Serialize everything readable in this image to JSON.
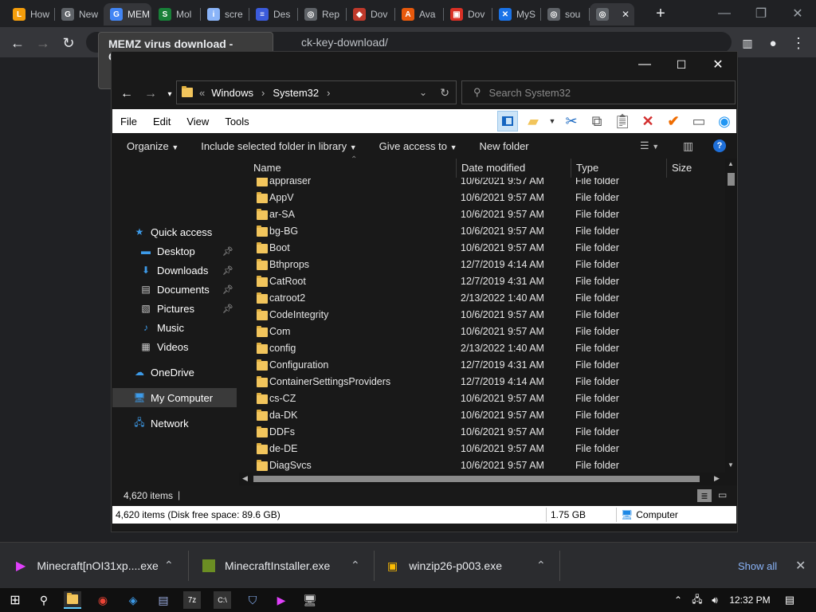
{
  "browser": {
    "tabs": [
      {
        "label": "How",
        "icon": "L",
        "color": "#f59e0b"
      },
      {
        "label": "New",
        "icon": "G",
        "color": "#5f6368"
      },
      {
        "label": "MEM",
        "icon": "G",
        "color": "#4285f4",
        "active": true
      },
      {
        "label": "Mol",
        "icon": "S",
        "color": "#188038"
      },
      {
        "label": "scre",
        "icon": "i",
        "color": "#8ab4f8"
      },
      {
        "label": "Des",
        "icon": "≡",
        "color": "#3b5bdb"
      },
      {
        "label": "Rep",
        "icon": "◎",
        "color": "#5f6368"
      },
      {
        "label": "Dov",
        "icon": "◆",
        "color": "#c0392b"
      },
      {
        "label": "Ava",
        "icon": "A",
        "color": "#e8590c"
      },
      {
        "label": "Dov",
        "icon": "▣",
        "color": "#d93025"
      },
      {
        "label": "MyS",
        "icon": "✕",
        "color": "#1a73e8"
      },
      {
        "label": "sou",
        "icon": "◎",
        "color": "#5f6368"
      },
      {
        "label": "",
        "icon": "◎",
        "color": "#5f6368"
      }
    ],
    "tab_close": "✕",
    "new_tab": "+",
    "url_partial": "ck-key-download/",
    "tooltip": "MEMZ virus download - Google"
  },
  "explorer": {
    "address": {
      "sep": "«",
      "parts": [
        "Windows",
        "System32"
      ]
    },
    "search_placeholder": "Search System32",
    "menu": [
      "File",
      "Edit",
      "View",
      "Tools"
    ],
    "commands": {
      "organize": "Organize",
      "include": "Include selected folder in library",
      "give_access": "Give access to",
      "new_folder": "New folder"
    },
    "nav": {
      "quick_access": "Quick access",
      "desktop": "Desktop",
      "downloads": "Downloads",
      "documents": "Documents",
      "pictures": "Pictures",
      "music": "Music",
      "videos": "Videos",
      "onedrive": "OneDrive",
      "my_computer": "My Computer",
      "network": "Network"
    },
    "columns": {
      "name": "Name",
      "date": "Date modified",
      "type": "Type",
      "size": "Size"
    },
    "files": [
      {
        "name": "appraiser",
        "date": "10/6/2021 9:57 AM",
        "type": "File folder"
      },
      {
        "name": "AppV",
        "date": "10/6/2021 9:57 AM",
        "type": "File folder"
      },
      {
        "name": "ar-SA",
        "date": "10/6/2021 9:57 AM",
        "type": "File folder"
      },
      {
        "name": "bg-BG",
        "date": "10/6/2021 9:57 AM",
        "type": "File folder"
      },
      {
        "name": "Boot",
        "date": "10/6/2021 9:57 AM",
        "type": "File folder"
      },
      {
        "name": "Bthprops",
        "date": "12/7/2019 4:14 AM",
        "type": "File folder"
      },
      {
        "name": "CatRoot",
        "date": "12/7/2019 4:31 AM",
        "type": "File folder"
      },
      {
        "name": "catroot2",
        "date": "2/13/2022 1:40 AM",
        "type": "File folder"
      },
      {
        "name": "CodeIntegrity",
        "date": "10/6/2021 9:57 AM",
        "type": "File folder"
      },
      {
        "name": "Com",
        "date": "10/6/2021 9:57 AM",
        "type": "File folder"
      },
      {
        "name": "config",
        "date": "2/13/2022 1:40 AM",
        "type": "File folder"
      },
      {
        "name": "Configuration",
        "date": "12/7/2019 4:31 AM",
        "type": "File folder"
      },
      {
        "name": "ContainerSettingsProviders",
        "date": "12/7/2019 4:14 AM",
        "type": "File folder"
      },
      {
        "name": "cs-CZ",
        "date": "10/6/2021 9:57 AM",
        "type": "File folder"
      },
      {
        "name": "da-DK",
        "date": "10/6/2021 9:57 AM",
        "type": "File folder"
      },
      {
        "name": "DDFs",
        "date": "10/6/2021 9:57 AM",
        "type": "File folder"
      },
      {
        "name": "de-DE",
        "date": "10/6/2021 9:57 AM",
        "type": "File folder"
      },
      {
        "name": "DiagSvcs",
        "date": "10/6/2021 9:57 AM",
        "type": "File folder"
      }
    ],
    "item_count": "4,620 items",
    "status": {
      "summary": "4,620 items (Disk free space: 89.6 GB)",
      "size": "1.75 GB",
      "location": "Computer"
    }
  },
  "downloads": {
    "items": [
      "Minecraft[nOI31xp....exe",
      "MinecraftInstaller.exe",
      "winzip26-p003.exe"
    ],
    "show_all": "Show all",
    "close": "✕"
  },
  "taskbar": {
    "time": "12:32 PM"
  }
}
